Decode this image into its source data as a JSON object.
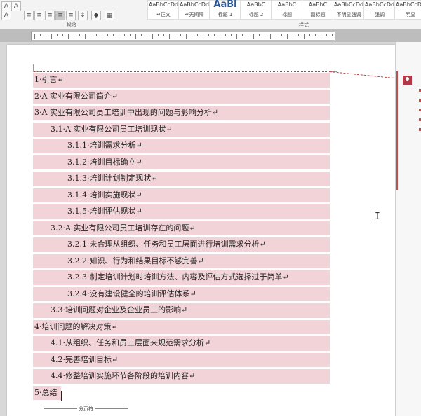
{
  "ribbon": {
    "paragraph_group_label": "段落",
    "styles_group_label": "样式",
    "styles": [
      {
        "preview": "AaBbCcDd",
        "name": "↵正文"
      },
      {
        "preview": "AaBbCcDd",
        "name": "↵无间隔"
      },
      {
        "preview": "AaBl",
        "name": "标题 1"
      },
      {
        "preview": "AaBbC",
        "name": "标题 2"
      },
      {
        "preview": "AaBbC",
        "name": "标题"
      },
      {
        "preview": "AaBbC",
        "name": "副标题"
      },
      {
        "preview": "AaBbCcDd",
        "name": "不明显强调"
      },
      {
        "preview": "AaBbCcDd",
        "name": "强调"
      },
      {
        "preview": "AaBbCcDd",
        "name": "明显"
      }
    ]
  },
  "document": {
    "toc": [
      {
        "text": "1·引言↵",
        "level": 1
      },
      {
        "text": "2·A 实业有限公司简介↵",
        "level": 1
      },
      {
        "text": "3·A 实业有限公司员工培训中出现的问题与影响分析↵",
        "level": 1
      },
      {
        "text": "3.1·A 实业有限公司员工培训现状↵",
        "level": 2
      },
      {
        "text": "3.1.1·培训需求分析↵",
        "level": 3
      },
      {
        "text": "3.1.2·培训目标确立↵",
        "level": 3
      },
      {
        "text": "3.1.3·培训计划制定现状↵",
        "level": 3
      },
      {
        "text": "3.1.4·培训实施现状↵",
        "level": 3
      },
      {
        "text": "3.1.5·培训评估现状↵",
        "level": 3
      },
      {
        "text": "3.2·A 实业有限公司员工培训存在的问题↵",
        "level": 2
      },
      {
        "text": "3.2.1·未合理从组织、任务和员工层面进行培训需求分析↵",
        "level": 3
      },
      {
        "text": "3.2.2·知识、行为和结果目标不够完善↵",
        "level": 3
      },
      {
        "text": "3.2.3·制定培训计划时培训方法、内容及评估方式选择过于简单↵",
        "level": 3
      },
      {
        "text": "3.2.4·没有建设健全的培训评估体系↵",
        "level": 3
      },
      {
        "text": "3.3·培训问题对企业及企业员工的影响↵",
        "level": 2
      },
      {
        "text": "4·培训问题的解决对策↵",
        "level": 1
      },
      {
        "text": "4.1·从组织、任务和员工层面来规范需求分析↵",
        "level": 2
      },
      {
        "text": "4.2·完善培训目标↵",
        "level": 2
      },
      {
        "text": "4.4·修整培训实施环节各阶段的培训内容↵",
        "level": 2
      },
      {
        "text": "5·总结",
        "level": 1
      }
    ],
    "section_break_label": "分页符"
  },
  "colors": {
    "highlight": "#f2d4d8",
    "comment_accent": "#c0504d",
    "spellcheck": "#3b5fd0"
  }
}
